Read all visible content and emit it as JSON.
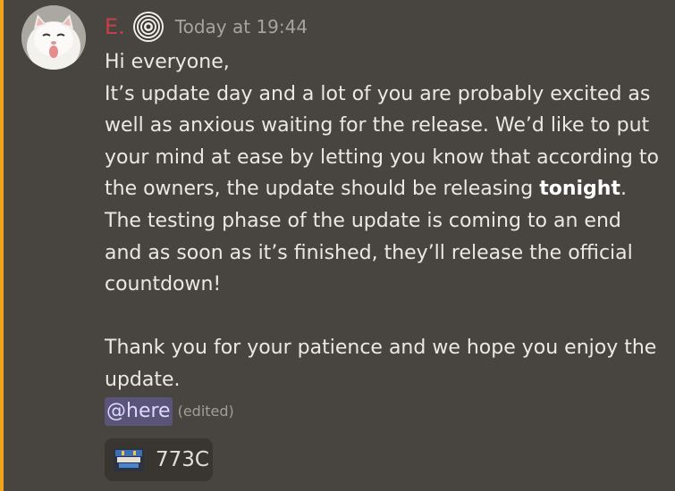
{
  "message": {
    "author": {
      "name": "E.",
      "avatar_icon": "white-cat-tongue-out",
      "role_icon": "concentric-rings-icon",
      "name_color": "#c93f47"
    },
    "timestamp": "Today at 19:44",
    "content": {
      "before_bold": "Hi everyone,\nIt’s update day and a lot of you are probably excited as well as anxious waiting for the release. We’d like to put your mind at ease by letting you know that according to the owners, the update should be releasing ",
      "bold": "tonight",
      "after_bold": ". The testing phase of the update is coming to an end and as soon as it’s finished, they’ll release the official countdown!\n\nThank you for your patience and we hope you enjoy the update."
    },
    "mention": "@here",
    "edited_label": "(edited)",
    "reaction": {
      "emoji_icon": "game-logo-emoji",
      "count": "773C"
    }
  },
  "colors": {
    "background": "#484440",
    "mention_highlight_bar": "#f0a31b",
    "mention_background": "#5a5479",
    "mention_text": "#dcd8ff",
    "reaction_background": "#393632"
  }
}
